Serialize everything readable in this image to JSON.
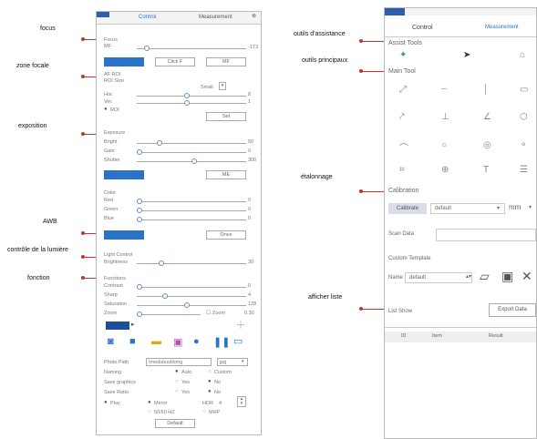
{
  "callouts": {
    "focus": "focus",
    "zone_focale": "zone focale",
    "exposition": "exposition",
    "awb": "AWB",
    "controle_lumiere": "contrôle de la lumière",
    "fonction": "fonction",
    "outils_assistance": "outils d'assistance",
    "outils_principaux": "outils principaux",
    "etalonnage": "étalonnage",
    "afficher_liste": "afficher liste"
  },
  "left_panel": {
    "tabs": [
      "Control",
      "Measurement"
    ],
    "focus": {
      "title": "Focus",
      "label": "MF",
      "value": "-173",
      "btn2": "Click F",
      "btn3": "MF"
    },
    "af_roi": {
      "title": "AF ROI",
      "roi_size_label": "ROI Size",
      "roi_size_value": "Small",
      "hor_label": "Hor.",
      "hor_value": "8",
      "ver_label": "Ver.",
      "ver_value": "1",
      "roi_radio": "ROI",
      "set_btn": "Set"
    },
    "exposure": {
      "title": "Exposure",
      "bright_label": "Bright",
      "bright_value": "50",
      "gain_label": "Gain",
      "gain_value": "0",
      "shutter_label": "Shutter",
      "shutter_value": "300",
      "btn2": "ME"
    },
    "color": {
      "title": "Color",
      "red_label": "Red",
      "red_value": "0",
      "green_label": "Green",
      "green_value": "0",
      "blue_label": "Blue",
      "blue_value": "0",
      "once_btn": "Once"
    },
    "light": {
      "title": "Light Control",
      "brightness_label": "Brightness",
      "brightness_value": "30"
    },
    "functions": {
      "title": "Functions",
      "contrast_label": "Contrast",
      "contrast_value": "0",
      "sharp_label": "Sharp",
      "sharp_value": "4",
      "saturation_label": "Saturation",
      "saturation_value": "128",
      "zoom_label": "Zoom",
      "zoom_value": "0.30",
      "zoom_check": "Zoom"
    },
    "settings": {
      "photo_path_label": "Photo Path",
      "photo_path_value": "\\media\\usb\\img",
      "format_value": "jpg",
      "naming_label": "Naming",
      "naming_auto": "Auto",
      "naming_custom": "Custom",
      "save_graphics_label": "Save graphics",
      "save_graphics_yes": "Yes",
      "save_graphics_no": "No",
      "save_ratio_label": "Save Ratio",
      "save_ratio_yes": "Yes",
      "save_ratio_no": "No",
      "play_label": "Play",
      "mirror_label": "Mirror",
      "hdr_label": "HDR",
      "hdr_value": "4",
      "sound_label": "50/60 HZ",
      "mhp_label": "MHP",
      "default_btn": "Default"
    }
  },
  "right_panel": {
    "tabs": [
      "Control",
      "Measurement"
    ],
    "assist_tools": "Assist Tools",
    "main_tool": "Main Tool",
    "calibration": "Calibration",
    "calibrate_btn": "Calibrate",
    "default_value": "default",
    "unit_value": "mm",
    "scan_data": "Scan Data",
    "custom_template": "Custom Template",
    "name_label": "Name",
    "name_value": "default",
    "list_show": "List Show",
    "export_btn": "Export Data",
    "table_headers": [
      "ID",
      "Item",
      "Result"
    ]
  },
  "colors": {
    "accent": "#2b73c9",
    "callout_line": "#c0392b"
  }
}
